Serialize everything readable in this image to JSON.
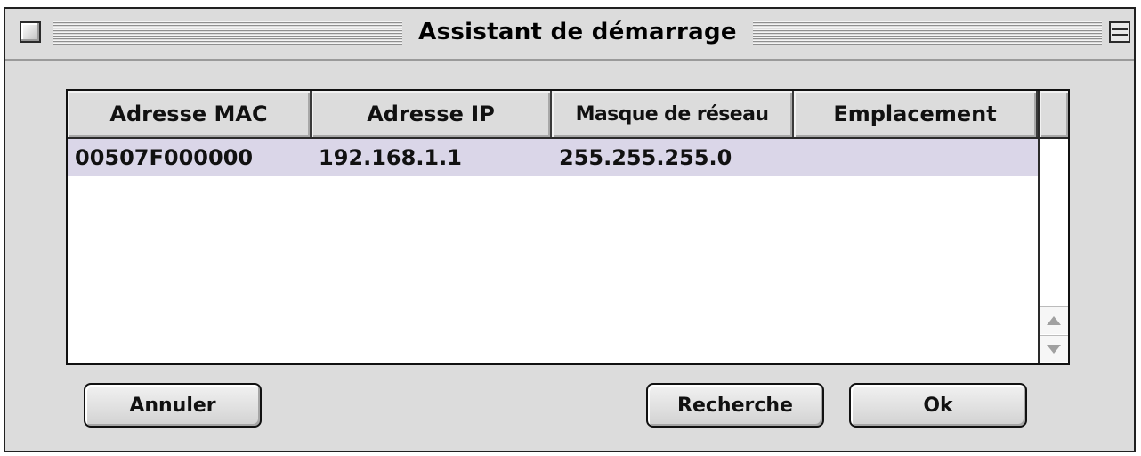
{
  "window": {
    "title": "Assistant de démarrage"
  },
  "table": {
    "columns": [
      "Adresse MAC",
      "Adresse IP",
      "Masque de réseau",
      "Emplacement"
    ],
    "rows": [
      [
        "00507F000000",
        "192.168.1.1",
        "255.255.255.0",
        ""
      ]
    ]
  },
  "buttons": {
    "cancel": "Annuler",
    "search": "Recherche",
    "ok": "Ok"
  },
  "colors": {
    "selected_row": "#dad6e8",
    "window_bg": "#dcdcdc"
  },
  "icons": {
    "close_box": "close-box-icon",
    "collapse_box": "collapse-box-icon",
    "scroll_up": "scroll-up-arrow-icon",
    "scroll_down": "scroll-down-arrow-icon"
  }
}
